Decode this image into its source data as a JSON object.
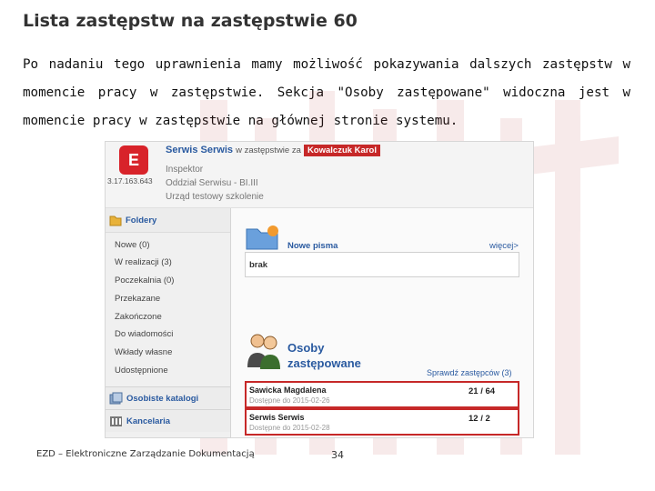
{
  "slide": {
    "title": "Lista zastępstw na zastępstwie 60",
    "paragraph": "Po nadaniu tego uprawnienia mamy możliwość pokazywania dalszych zastępstw w momencie pracy w zastępstwie. Sekcja \"Osoby zastępowane\" widoczna jest w momencie pracy w zastępstwie na głównej stronie systemu.",
    "footer_text": "EZD – Elektroniczne Zarządzanie Dokumentacją",
    "page_number": "34"
  },
  "screenshot": {
    "header": {
      "logo_glyph": "E",
      "ip": "3.17.163.643",
      "user_name": "Serwis Serwis",
      "in_substitution_text": "w zastępstwie za",
      "substituted_person": "Kowalczuk Karol",
      "role": "Inspektor",
      "department": "Oddział Serwisu - BI.III",
      "office": "Urząd testowy szkolenie"
    },
    "sidebar": {
      "folders_label": "Foldery",
      "items": [
        "Nowe (0)",
        "W realizacji (3)",
        "Poczekalnia (0)",
        "Przekazane",
        "Zakończone",
        "Do wiadomości",
        "Wkłady własne",
        "Udostępnione"
      ],
      "personal_catalogs_label": "Osobiste katalogi",
      "office_label": "Kancelaria"
    },
    "new_letters": {
      "title": "Nowe pisma",
      "more_link": "więcej>",
      "empty_value": "brak"
    },
    "substituted": {
      "title_line1": "Osoby",
      "title_line2": "zastępowane",
      "check_link": "Sprawdź zastępców (3)",
      "rows": [
        {
          "name": "Sawicka Magdalena",
          "sub": "Dostępne do 2015-02-26",
          "count": "21 / 64"
        },
        {
          "name": "Serwis Serwis",
          "sub": "Dostępne do 2015-02-28",
          "count": "12 / 2"
        }
      ]
    }
  },
  "colors": {
    "accent_blue": "#2a5aa0",
    "highlight_red": "#c62828"
  }
}
